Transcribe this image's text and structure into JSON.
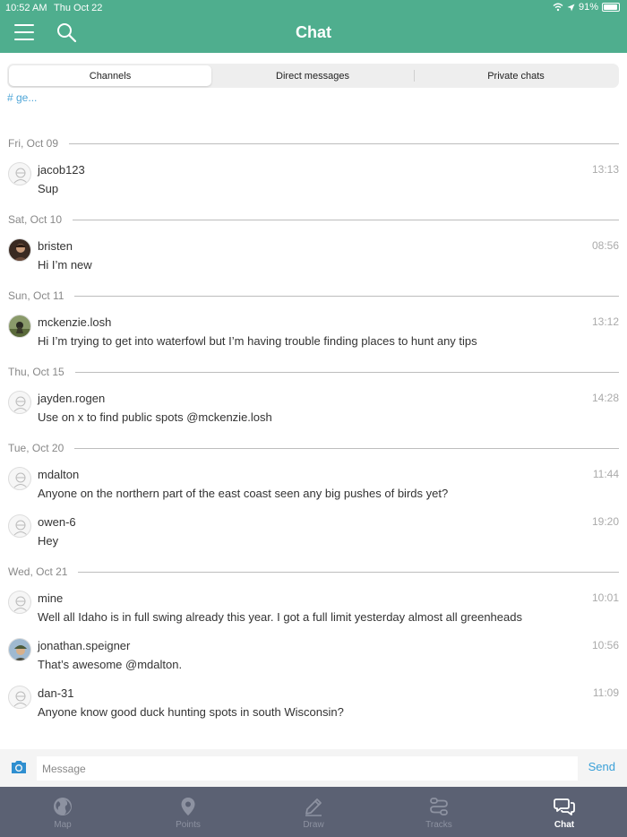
{
  "status_bar": {
    "time": "10:52 AM",
    "date": "Thu Oct 22",
    "battery": "91%"
  },
  "header": {
    "title": "Chat"
  },
  "tabs": [
    {
      "label": "Channels",
      "active": true
    },
    {
      "label": "Direct messages",
      "active": false
    },
    {
      "label": "Private chats",
      "active": false
    }
  ],
  "partial_channel": "# ge...",
  "dates": [
    "Fri, Oct 09",
    "Sat, Oct 10",
    "Sun, Oct 11",
    "Thu, Oct 15",
    "Tue, Oct 20",
    "Wed, Oct 21"
  ],
  "messages": [
    {
      "user": "jacob123",
      "time": "13:13",
      "text": "Sup",
      "avatar": "default"
    },
    {
      "user": "bristen",
      "time": "08:56",
      "text": "Hi I’m new",
      "avatar": "photo"
    },
    {
      "user": "mckenzie.losh",
      "time": "13:12",
      "text": "Hi I’m trying to get into waterfowl but I’m having trouble finding places to hunt any tips",
      "avatar": "photo"
    },
    {
      "user": "jayden.rogen",
      "time": "14:28",
      "text": "Use on x to find public spots @mckenzie.losh",
      "avatar": "default"
    },
    {
      "user": "mdalton",
      "time": "11:44",
      "text": "Anyone on the northern part of the east coast seen any big pushes of birds yet?",
      "avatar": "default"
    },
    {
      "user": "owen-6",
      "time": "19:20",
      "text": "Hey",
      "avatar": "default"
    },
    {
      "user": "mine",
      "time": "10:01",
      "text": "Well all Idaho is in full swing already this year. I got a full limit yesterday almost all greenheads",
      "avatar": "default"
    },
    {
      "user": "jonathan.speigner",
      "time": "10:56",
      "text": "That’s awesome @mdalton.",
      "avatar": "photo"
    },
    {
      "user": "dan-31",
      "time": "11:09",
      "text": "Anyone know good duck hunting spots in south Wisconsin?",
      "avatar": "default"
    }
  ],
  "composer": {
    "placeholder": "Message",
    "send_label": "Send"
  },
  "tabbar": [
    {
      "label": "Map",
      "icon": "globe-icon",
      "active": false
    },
    {
      "label": "Points",
      "icon": "map-pin-icon",
      "active": false
    },
    {
      "label": "Draw",
      "icon": "pencil-icon",
      "active": false
    },
    {
      "label": "Tracks",
      "icon": "route-icon",
      "active": false
    },
    {
      "label": "Chat",
      "icon": "chat-bubbles-icon",
      "active": true
    }
  ],
  "colors": {
    "header": "#4fae8e",
    "tabbar": "#5b6173",
    "link": "#3aa0d8"
  }
}
